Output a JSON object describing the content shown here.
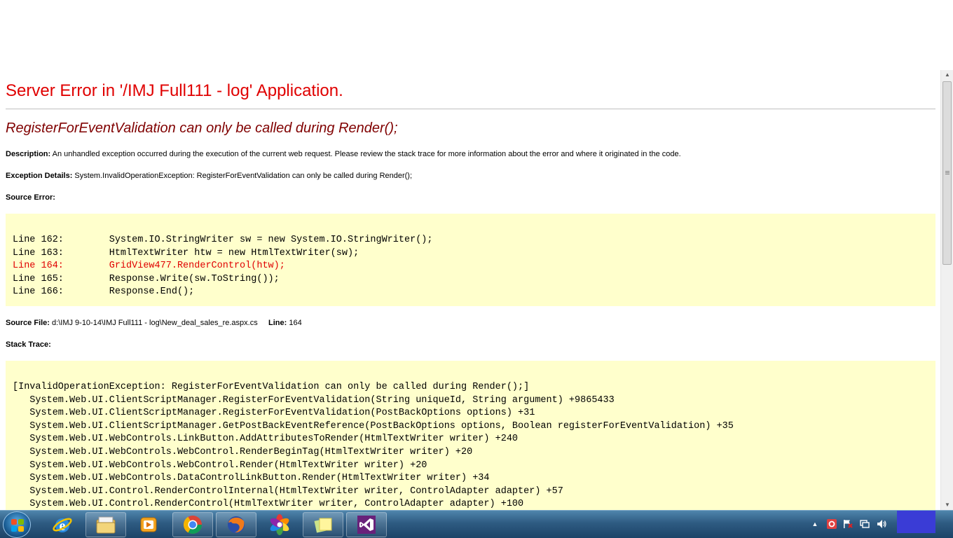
{
  "page": {
    "title": "Server Error in '/IMJ Full111 - log' Application.",
    "error_message": "RegisterForEventValidation can only be called during Render();",
    "description_label": "Description:",
    "description_text": "An unhandled exception occurred during the execution of the current web request. Please review the stack trace for more information about the error and where it originated in the code.",
    "exception_label": "Exception Details:",
    "exception_text": "System.InvalidOperationException: RegisterForEventValidation can only be called during Render();",
    "source_error_label": "Source Error:",
    "source_lines": [
      "Line 162:        System.IO.StringWriter sw = new System.IO.StringWriter();",
      "Line 163:        HtmlTextWriter htw = new HtmlTextWriter(sw);",
      "Line 164:        GridView477.RenderControl(htw);",
      "Line 165:        Response.Write(sw.ToString());",
      "Line 166:        Response.End();"
    ],
    "source_file_label": "Source File:",
    "source_file_value": "d:\\IMJ 9-10-14\\IMJ Full111 - log\\New_deal_sales_re.aspx.cs",
    "line_label": "Line:",
    "line_value": "164",
    "stack_trace_label": "Stack Trace:",
    "stack_lines": [
      "[InvalidOperationException: RegisterForEventValidation can only be called during Render();]",
      "   System.Web.UI.ClientScriptManager.RegisterForEventValidation(String uniqueId, String argument) +9865433",
      "   System.Web.UI.ClientScriptManager.RegisterForEventValidation(PostBackOptions options) +31",
      "   System.Web.UI.ClientScriptManager.GetPostBackEventReference(PostBackOptions options, Boolean registerForEventValidation) +35",
      "   System.Web.UI.WebControls.LinkButton.AddAttributesToRender(HtmlTextWriter writer) +240",
      "   System.Web.UI.WebControls.WebControl.RenderBeginTag(HtmlTextWriter writer) +20",
      "   System.Web.UI.WebControls.WebControl.Render(HtmlTextWriter writer) +20",
      "   System.Web.UI.WebControls.DataControlLinkButton.Render(HtmlTextWriter writer) +34",
      "   System.Web.UI.Control.RenderControlInternal(HtmlTextWriter writer, ControlAdapter adapter) +57",
      "   System.Web.UI.Control.RenderControl(HtmlTextWriter writer, ControlAdapter adapter) +100"
    ]
  },
  "colors": {
    "title": "#e00000",
    "error_message": "#800000",
    "code_background": "#ffffcc",
    "highlight_line": "#e00000"
  },
  "taskbar": {
    "items": [
      {
        "name": "start-button",
        "icon": "windows-logo-icon"
      },
      {
        "name": "internet-explorer",
        "icon": "internet-explorer-icon"
      },
      {
        "name": "windows-explorer",
        "icon": "folder-icon"
      },
      {
        "name": "media-player",
        "icon": "media-player-icon"
      },
      {
        "name": "google-chrome",
        "icon": "chrome-icon"
      },
      {
        "name": "firefox",
        "icon": "firefox-icon"
      },
      {
        "name": "picasa",
        "icon": "picasa-icon"
      },
      {
        "name": "sticky-notes",
        "icon": "sticky-notes-icon"
      },
      {
        "name": "visual-studio",
        "icon": "visual-studio-icon"
      }
    ],
    "tray": [
      "show-hidden-icons-arrow",
      "antivirus-icon",
      "flag-icon",
      "network-icon",
      "volume-icon"
    ]
  }
}
